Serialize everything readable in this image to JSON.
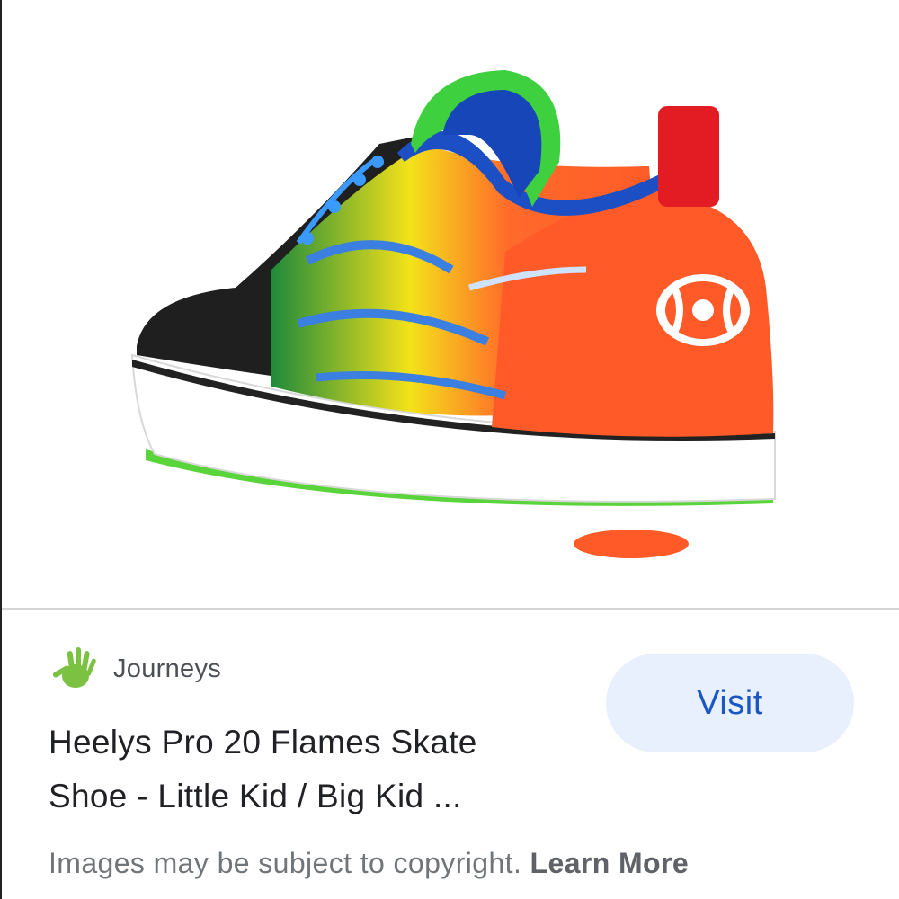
{
  "result": {
    "source_name": "Journeys",
    "title_line1": "Heelys Pro 20 Flames Skate",
    "title_line2": "Shoe - Little Kid / Big Kid ...",
    "visit_label": "Visit"
  },
  "footer": {
    "notice": "Images may be subject to copyright.",
    "learn_more": "Learn More"
  },
  "icons": {
    "source_logo": "green-hand-logo-icon"
  },
  "colors": {
    "button_bg": "#e8f0fe",
    "button_text": "#1a57c4",
    "logo_green": "#7cc242"
  }
}
